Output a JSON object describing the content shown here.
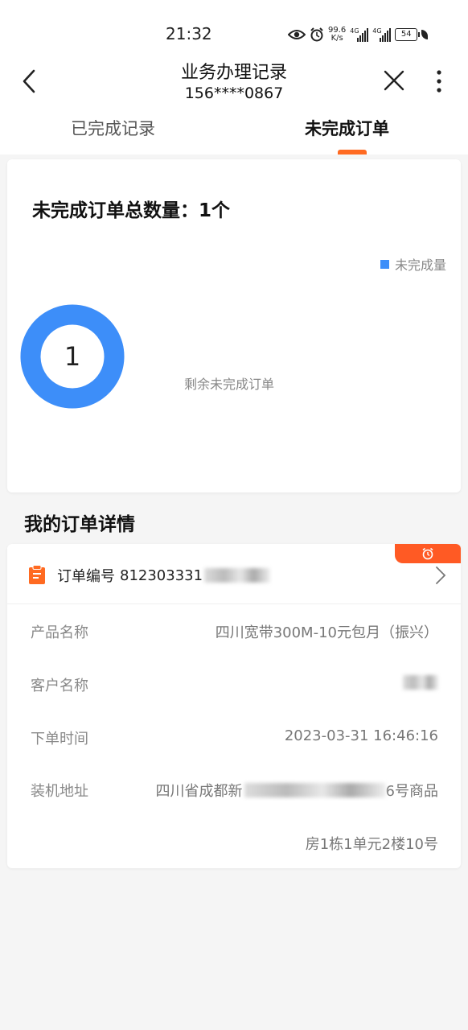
{
  "status_bar": {
    "time": "21:32",
    "net_speed_value": "99.6",
    "net_speed_unit": "K/s",
    "signal_1_tag": "4G",
    "signal_2_tag": "4G",
    "battery": "54"
  },
  "nav": {
    "title": "业务办理记录",
    "subtitle": "156****0867"
  },
  "tabs": [
    {
      "label": "已完成记录",
      "selected": false
    },
    {
      "label": "未完成订单",
      "selected": true
    }
  ],
  "summary": {
    "title": "未完成订单总数量：1个",
    "legend_label": "未完成量",
    "donut_value": "1",
    "caption": "剩余未完成订单"
  },
  "details": {
    "section_title": "我的订单详情",
    "order_number_label": "订单编号",
    "order_number_visible": "812303331",
    "rows": [
      {
        "label": "产品名称",
        "value": "四川宽带300M-10元包月（振兴）"
      },
      {
        "label": "客户名称",
        "value": ""
      },
      {
        "label": "下单时间",
        "value": "2023-03-31 16:46:16"
      },
      {
        "label": "装机地址",
        "value": "四川省成都新",
        "value_tail": "6号商品"
      }
    ],
    "address_line2": "房1栋1单元2楼10号"
  },
  "colors": {
    "accent": "#ff6a21",
    "chart_blue": "#3d8ef9",
    "badge": "#ff5a24"
  },
  "chart_data": {
    "type": "pie",
    "categories": [
      "未完成量"
    ],
    "values": [
      1
    ],
    "title": "未完成订单总数量：1个",
    "center_label": "1",
    "legend": "top-right"
  }
}
